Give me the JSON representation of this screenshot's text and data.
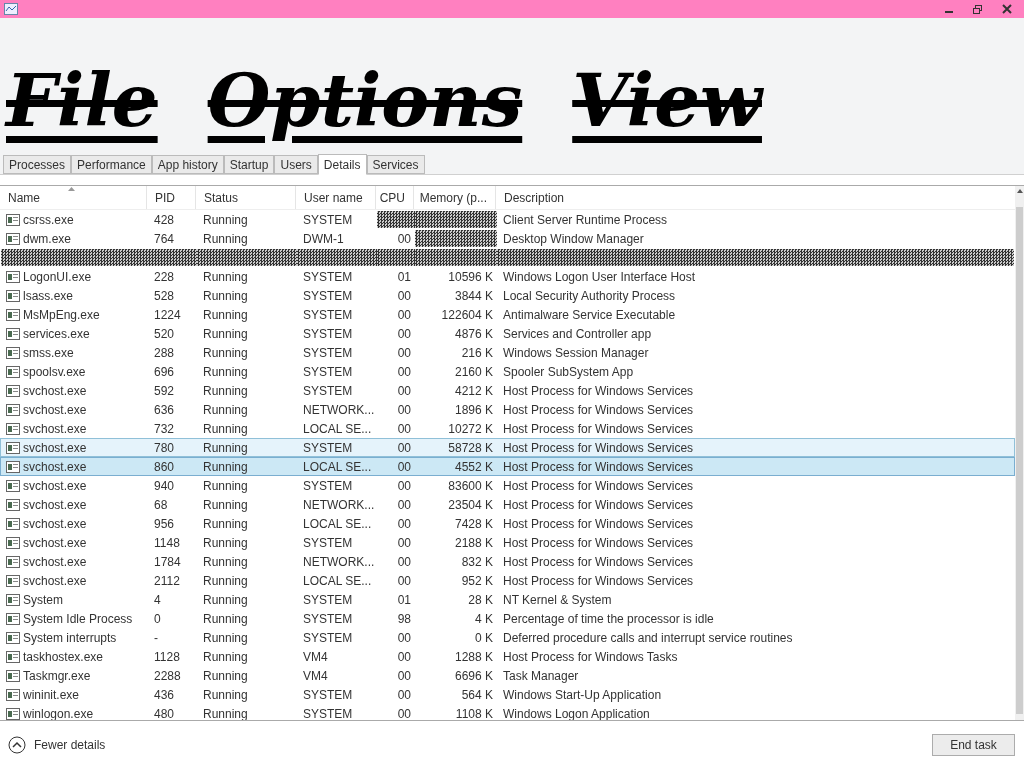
{
  "menu": [
    "File",
    "Options",
    "View"
  ],
  "tabs": [
    {
      "label": "Processes",
      "selected": false
    },
    {
      "label": "Performance",
      "selected": false
    },
    {
      "label": "App history",
      "selected": false
    },
    {
      "label": "Startup",
      "selected": false
    },
    {
      "label": "Users",
      "selected": false
    },
    {
      "label": "Details",
      "selected": true
    },
    {
      "label": "Services",
      "selected": false
    }
  ],
  "columns": [
    "Name",
    "PID",
    "Status",
    "User name",
    "CPU",
    "Memory (p...",
    "Description"
  ],
  "rows": [
    {
      "name": "csrss.exe",
      "pid": "428",
      "status": "Running",
      "user": "SYSTEM",
      "description": "Client Server Runtime Process",
      "selected": false,
      "hovered": false
    },
    {
      "name": "dwm.exe",
      "pid": "764",
      "status": "Running",
      "user": "DWM-1",
      "cpu": "00",
      "description": "Desktop Window Manager",
      "selected": false,
      "hovered": false
    },
    {
      "selected": false,
      "hovered": false
    },
    {
      "name": "LogonUI.exe",
      "pid": "228",
      "status": "Running",
      "user": "SYSTEM",
      "cpu": "01",
      "memory": "10596 K",
      "description": "Windows Logon User Interface Host",
      "selected": false,
      "hovered": false
    },
    {
      "name": "lsass.exe",
      "pid": "528",
      "status": "Running",
      "user": "SYSTEM",
      "cpu": "00",
      "memory": "3844 K",
      "description": "Local Security Authority Process",
      "selected": false,
      "hovered": false
    },
    {
      "name": "MsMpEng.exe",
      "pid": "1224",
      "status": "Running",
      "user": "SYSTEM",
      "cpu": "00",
      "memory": "122604 K",
      "description": "Antimalware Service Executable",
      "selected": false,
      "hovered": false
    },
    {
      "name": "services.exe",
      "pid": "520",
      "status": "Running",
      "user": "SYSTEM",
      "cpu": "00",
      "memory": "4876 K",
      "description": "Services and Controller app",
      "selected": false,
      "hovered": false
    },
    {
      "name": "smss.exe",
      "pid": "288",
      "status": "Running",
      "user": "SYSTEM",
      "cpu": "00",
      "memory": "216 K",
      "description": "Windows Session Manager",
      "selected": false,
      "hovered": false
    },
    {
      "name": "spoolsv.exe",
      "pid": "696",
      "status": "Running",
      "user": "SYSTEM",
      "cpu": "00",
      "memory": "2160 K",
      "description": "Spooler SubSystem App",
      "selected": false,
      "hovered": false
    },
    {
      "name": "svchost.exe",
      "pid": "592",
      "status": "Running",
      "user": "SYSTEM",
      "cpu": "00",
      "memory": "4212 K",
      "description": "Host Process for Windows Services",
      "selected": false,
      "hovered": false
    },
    {
      "name": "svchost.exe",
      "pid": "636",
      "status": "Running",
      "user": "NETWORK...",
      "cpu": "00",
      "memory": "1896 K",
      "description": "Host Process for Windows Services",
      "selected": false,
      "hovered": false
    },
    {
      "name": "svchost.exe",
      "pid": "732",
      "status": "Running",
      "user": "LOCAL SE...",
      "cpu": "00",
      "memory": "10272 K",
      "description": "Host Process for Windows Services",
      "selected": false,
      "hovered": false
    },
    {
      "name": "svchost.exe",
      "pid": "780",
      "status": "Running",
      "user": "SYSTEM",
      "cpu": "00",
      "memory": "58728 K",
      "description": "Host Process for Windows Services",
      "selected": false,
      "hovered": true
    },
    {
      "name": "svchost.exe",
      "pid": "860",
      "status": "Running",
      "user": "LOCAL SE...",
      "cpu": "00",
      "memory": "4552 K",
      "description": "Host Process for Windows Services",
      "selected": true,
      "hovered": false
    },
    {
      "name": "svchost.exe",
      "pid": "940",
      "status": "Running",
      "user": "SYSTEM",
      "cpu": "00",
      "memory": "83600 K",
      "description": "Host Process for Windows Services",
      "selected": false,
      "hovered": false
    },
    {
      "name": "svchost.exe",
      "pid": "68",
      "status": "Running",
      "user": "NETWORK...",
      "cpu": "00",
      "memory": "23504 K",
      "description": "Host Process for Windows Services",
      "selected": false,
      "hovered": false
    },
    {
      "name": "svchost.exe",
      "pid": "956",
      "status": "Running",
      "user": "LOCAL SE...",
      "cpu": "00",
      "memory": "7428 K",
      "description": "Host Process for Windows Services",
      "selected": false,
      "hovered": false
    },
    {
      "name": "svchost.exe",
      "pid": "1148",
      "status": "Running",
      "user": "SYSTEM",
      "cpu": "00",
      "memory": "2188 K",
      "description": "Host Process for Windows Services",
      "selected": false,
      "hovered": false
    },
    {
      "name": "svchost.exe",
      "pid": "1784",
      "status": "Running",
      "user": "NETWORK...",
      "cpu": "00",
      "memory": "832 K",
      "description": "Host Process for Windows Services",
      "selected": false,
      "hovered": false
    },
    {
      "name": "svchost.exe",
      "pid": "2112",
      "status": "Running",
      "user": "LOCAL SE...",
      "cpu": "00",
      "memory": "952 K",
      "description": "Host Process for Windows Services",
      "selected": false,
      "hovered": false
    },
    {
      "name": "System",
      "pid": "4",
      "status": "Running",
      "user": "SYSTEM",
      "cpu": "01",
      "memory": "28 K",
      "description": "NT Kernel & System",
      "selected": false,
      "hovered": false
    },
    {
      "name": "System Idle Process",
      "pid": "0",
      "status": "Running",
      "user": "SYSTEM",
      "cpu": "98",
      "memory": "4 K",
      "description": "Percentage of time the processor is idle",
      "selected": false,
      "hovered": false
    },
    {
      "name": "System interrupts",
      "pid": "-",
      "status": "Running",
      "user": "SYSTEM",
      "cpu": "00",
      "memory": "0 K",
      "description": "Deferred procedure calls and interrupt service routines",
      "selected": false,
      "hovered": false
    },
    {
      "name": "taskhostex.exe",
      "pid": "1128",
      "status": "Running",
      "user": "VM4",
      "cpu": "00",
      "memory": "1288 K",
      "description": "Host Process for Windows Tasks",
      "selected": false,
      "hovered": false
    },
    {
      "name": "Taskmgr.exe",
      "pid": "2288",
      "status": "Running",
      "user": "VM4",
      "cpu": "00",
      "memory": "6696 K",
      "description": "Task Manager",
      "selected": false,
      "hovered": false
    },
    {
      "name": "wininit.exe",
      "pid": "436",
      "status": "Running",
      "user": "SYSTEM",
      "cpu": "00",
      "memory": "564 K",
      "description": "Windows Start-Up Application",
      "selected": false,
      "hovered": false
    },
    {
      "name": "winlogon.exe",
      "pid": "480",
      "status": "Running",
      "user": "SYSTEM",
      "cpu": "00",
      "memory": "1108 K",
      "description": "Windows Logon Application",
      "selected": false,
      "hovered": false
    }
  ],
  "footer": {
    "toggle": "Fewer details",
    "button": "End task"
  }
}
